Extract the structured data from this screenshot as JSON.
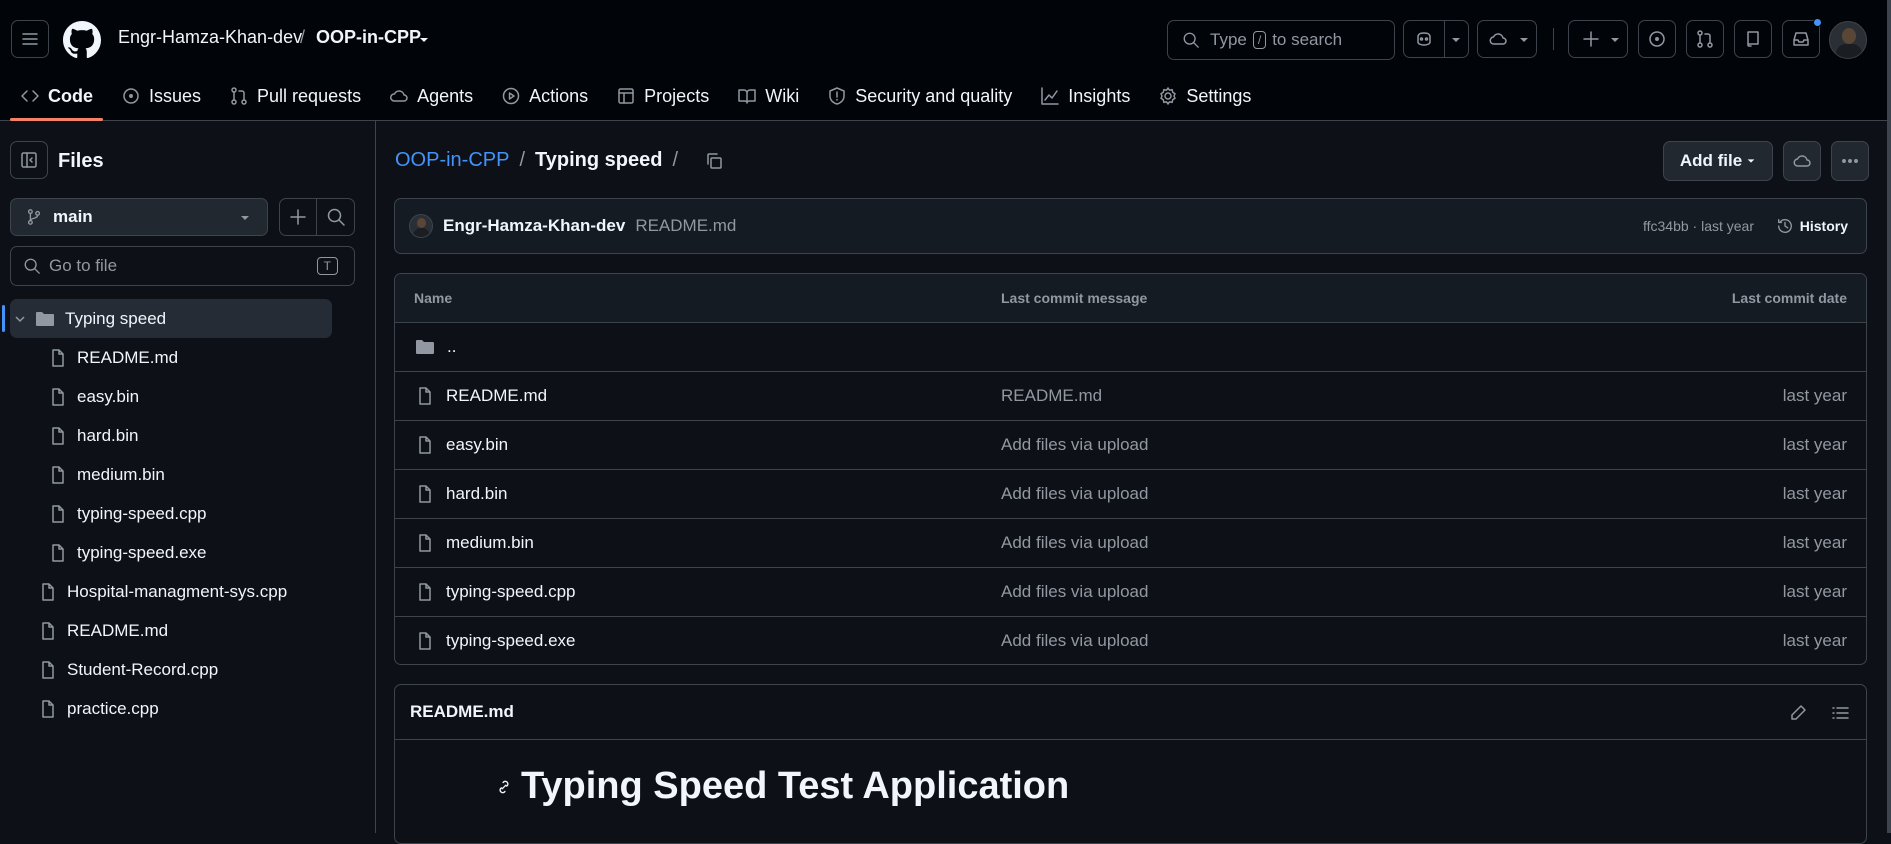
{
  "header": {
    "owner": "Engr-Hamza-Khan-dev",
    "separator": "/",
    "repo": "OOP-in-CPP",
    "search_pre": "Type",
    "search_key": "/",
    "search_post": "to search"
  },
  "nav": [
    {
      "label": "Code",
      "icon": "code-icon",
      "active": true
    },
    {
      "label": "Issues",
      "icon": "issue-icon"
    },
    {
      "label": "Pull requests",
      "icon": "pull-request-icon"
    },
    {
      "label": "Agents",
      "icon": "agents-icon"
    },
    {
      "label": "Actions",
      "icon": "play-icon"
    },
    {
      "label": "Projects",
      "icon": "table-icon"
    },
    {
      "label": "Wiki",
      "icon": "book-icon"
    },
    {
      "label": "Security and quality",
      "icon": "shield-icon"
    },
    {
      "label": "Insights",
      "icon": "graph-icon"
    },
    {
      "label": "Settings",
      "icon": "gear-icon"
    }
  ],
  "sidebar": {
    "title": "Files",
    "branch": "main",
    "gofile_placeholder": "Go to file",
    "gofile_key": "T",
    "tree": [
      {
        "label": "Typing speed",
        "type": "folder",
        "level": 0,
        "selected": true
      },
      {
        "label": "README.md",
        "type": "file",
        "level": 1
      },
      {
        "label": "easy.bin",
        "type": "file",
        "level": 1
      },
      {
        "label": "hard.bin",
        "type": "file",
        "level": 1
      },
      {
        "label": "medium.bin",
        "type": "file",
        "level": 1
      },
      {
        "label": "typing-speed.cpp",
        "type": "file",
        "level": 1
      },
      {
        "label": "typing-speed.exe",
        "type": "file",
        "level": 1
      },
      {
        "label": "Hospital-managment-sys.cpp",
        "type": "file",
        "level": 0
      },
      {
        "label": "README.md",
        "type": "file",
        "level": 0
      },
      {
        "label": "Student-Record.cpp",
        "type": "file",
        "level": 0
      },
      {
        "label": "practice.cpp",
        "type": "file",
        "level": 0
      }
    ]
  },
  "main": {
    "breadcrumb_repo": "OOP-in-CPP",
    "breadcrumb_sep": "/",
    "breadcrumb_folder": "Typing speed",
    "add_file": "Add file",
    "commit_author": "Engr-Hamza-Khan-dev",
    "commit_message": "README.md",
    "commit_meta": "ffc34bb · last year",
    "history": "History",
    "col_name": "Name",
    "col_message": "Last commit message",
    "col_date": "Last commit date",
    "parent_dir": "..",
    "files": [
      {
        "name": "README.md",
        "message": "README.md",
        "date": "last year"
      },
      {
        "name": "easy.bin",
        "message": "Add files via upload",
        "date": "last year"
      },
      {
        "name": "hard.bin",
        "message": "Add files via upload",
        "date": "last year"
      },
      {
        "name": "medium.bin",
        "message": "Add files via upload",
        "date": "last year"
      },
      {
        "name": "typing-speed.cpp",
        "message": "Add files via upload",
        "date": "last year"
      },
      {
        "name": "typing-speed.exe",
        "message": "Add files via upload",
        "date": "last year"
      }
    ],
    "readme_title": "README.md",
    "readme_heading": "Typing Speed Test Application"
  },
  "colors": {
    "accent_link": "#4493f8",
    "active_underline": "#f78166",
    "notification": "#4493f8"
  }
}
